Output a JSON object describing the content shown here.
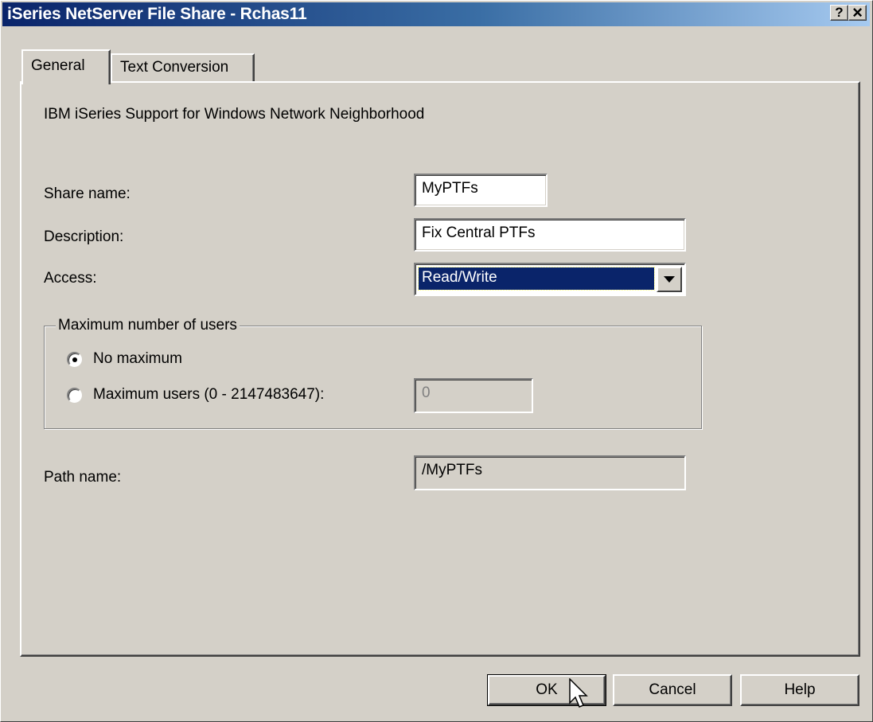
{
  "window": {
    "title": "iSeries NetServer File Share - Rchas11",
    "help_button": "?",
    "close_button": "×"
  },
  "tabs": [
    {
      "label": "General",
      "active": true
    },
    {
      "label": "Text Conversion",
      "active": false
    }
  ],
  "general": {
    "heading": "IBM iSeries Support for Windows Network Neighborhood",
    "share_name_label": "Share name:",
    "share_name_value": "MyPTFs",
    "description_label": "Description:",
    "description_value": "Fix Central PTFs",
    "access_label": "Access:",
    "access_value": "Read/Write",
    "max_users_group": {
      "label": "Maximum number of users",
      "no_maximum_label": "No maximum",
      "no_maximum_selected": true,
      "maximum_users_label": "Maximum users (0 - 2147483647):",
      "maximum_users_selected": false,
      "maximum_users_value": "0"
    },
    "path_name_label": "Path name:",
    "path_name_value": "/MyPTFs"
  },
  "buttons": {
    "ok": "OK",
    "cancel": "Cancel",
    "help": "Help"
  },
  "colors": {
    "title_bar_start": "#0a246a",
    "title_bar_end": "#a6caf0",
    "selection_highlight": "#0a246a",
    "dialog_face": "#d4d0c8"
  },
  "icons": {
    "help": "help-question-icon",
    "close": "close-icon",
    "dropdown": "chevron-down-icon",
    "cursor": "mouse-pointer-icon"
  }
}
